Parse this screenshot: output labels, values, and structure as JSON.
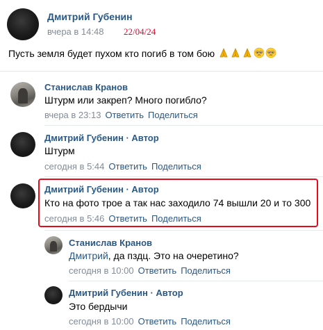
{
  "post": {
    "author": "Дмитрий Губенин",
    "time": "вчера в 14:48",
    "date_note": "22/04/24",
    "text": "Пусть земля будет пухом кто погиб в том бою",
    "emojis": [
      "folded-hands",
      "folded-hands",
      "folded-hands",
      "pleading-face",
      "pleading-face"
    ]
  },
  "actions": {
    "reply": "Ответить",
    "share": "Поделиться"
  },
  "comments": [
    {
      "author": "Станислав Кранов",
      "text": "Штурм или закреп? Много погибло?",
      "time": "вчера в 23:13"
    },
    {
      "author": "Дмитрий Губенин · Автор",
      "text": "Штурм",
      "time": "сегодня в 5:44"
    },
    {
      "author": "Дмитрий Губенин · Автор",
      "text": "Кто на фото трое а так нас заходило 74 вышли 20 и то 300",
      "time": "сегодня в 5:46"
    },
    {
      "author": "Станислав Кранов",
      "mention": "Дмитрий",
      "text": ", да пздц. Это на очеретино?",
      "time": "сегодня в 10:00"
    },
    {
      "author": "Дмитрий Губенин · Автор",
      "text": "Это бердычи",
      "time": "сегодня в 10:00"
    }
  ]
}
